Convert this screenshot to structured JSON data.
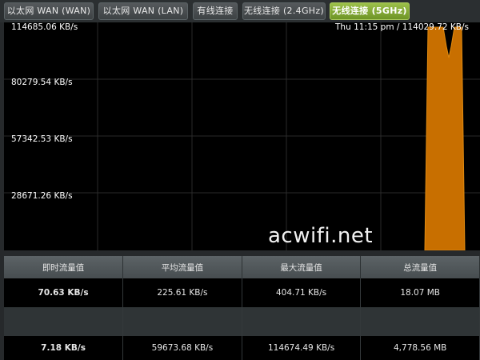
{
  "tabs": [
    {
      "label": "以太网 WAN (WAN)",
      "active": false
    },
    {
      "label": "以太网 WAN (LAN)",
      "active": false
    },
    {
      "label": "有线连接",
      "active": false
    },
    {
      "label": "无线连接 (2.4GHz)",
      "active": false
    },
    {
      "label": "无线连接 (5GHz)",
      "active": true
    }
  ],
  "graph": {
    "y_labels": [
      "114685.06 KB/s",
      "80279.54 KB/s",
      "57342.53 KB/s",
      "28671.26 KB/s"
    ],
    "readout": "Thu 11:15 pm / 114029.72 KB/s",
    "series_color": "#c86f00",
    "background": "#000000"
  },
  "watermark": "acwifi.net",
  "stats": {
    "headers": [
      "即时流量值",
      "平均流量值",
      "最大流量值",
      "总流量值"
    ],
    "rows": [
      {
        "current": "70.63 KB/s",
        "average": "225.61 KB/s",
        "max": "404.71 KB/s",
        "total": "18.07 MB",
        "color": "#3fa9f5"
      },
      {
        "current": "7.18 KB/s",
        "average": "59673.68 KB/s",
        "max": "114674.49 KB/s",
        "total": "4,778.56 MB",
        "color": "#ff8c1a"
      }
    ]
  }
}
